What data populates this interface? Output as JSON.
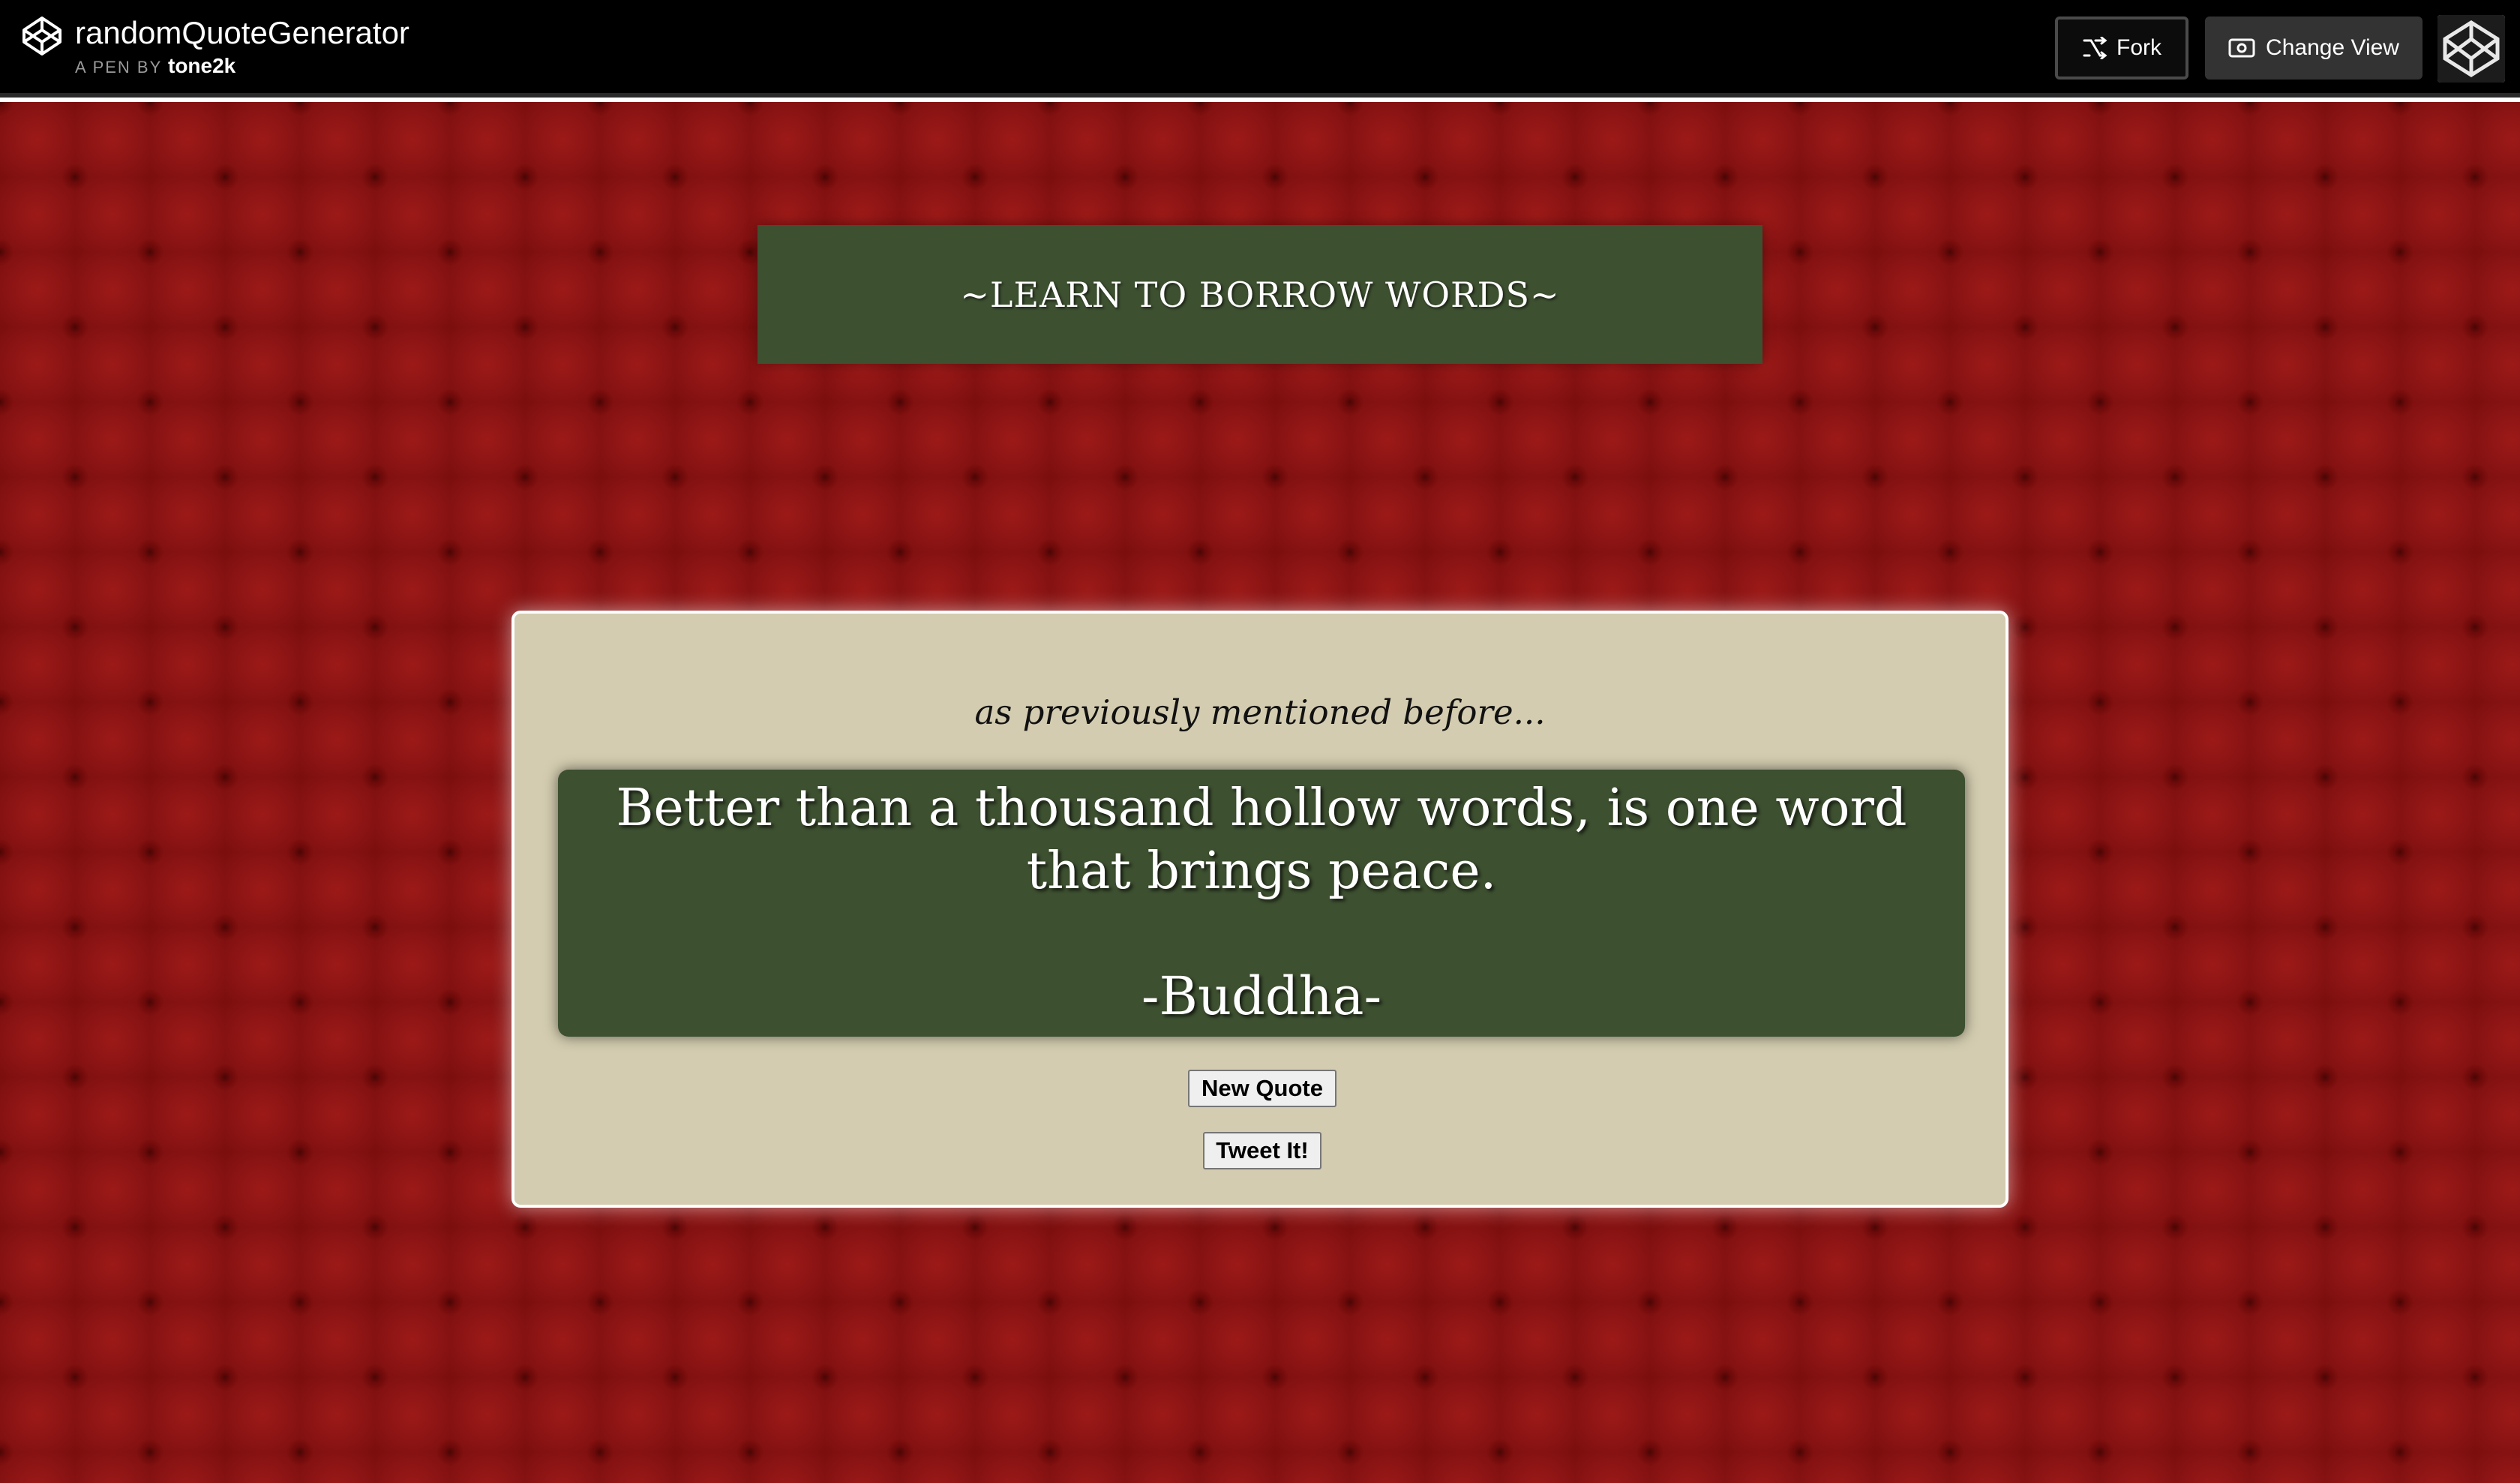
{
  "header": {
    "title": "randomQuoteGenerator",
    "byline_prefix": "A PEN BY",
    "author": "tone2k",
    "fork_label": "Fork",
    "change_view_label": "Change View",
    "icons": {
      "logo": "codepen-logo-icon",
      "fork": "fork-icon",
      "change_view": "eye-icon",
      "avatar": "user-avatar"
    }
  },
  "banner": {
    "text": "~LEARN TO BORROW WORDS~"
  },
  "card": {
    "intro": "as previously mentioned before...",
    "quote": "Better than a thousand hollow words, is one word that brings peace.",
    "author": "-Buddha-",
    "new_quote_label": "New Quote",
    "tweet_label": "Tweet It!"
  },
  "colors": {
    "header_bg": "#000000",
    "background_red": "#7d0e0e",
    "green_panel": "#3d5030",
    "card_bg": "#d3ccb0"
  }
}
